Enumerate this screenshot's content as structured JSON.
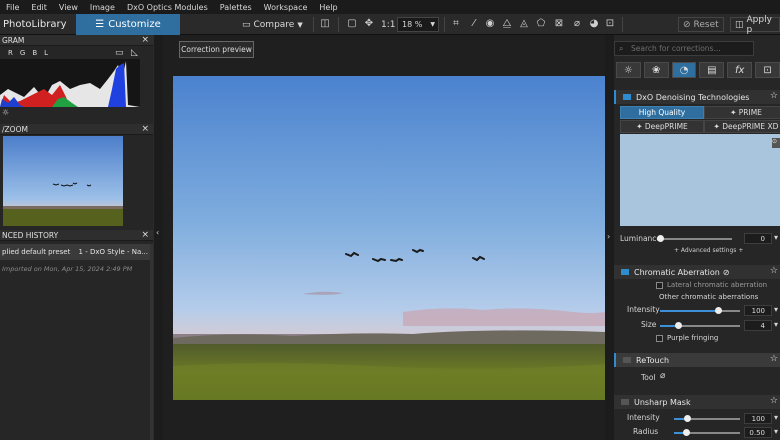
{
  "menu": [
    "File",
    "Edit",
    "View",
    "Image",
    "DxO Optics Modules",
    "Palettes",
    "Workspace",
    "Help"
  ],
  "toolbar": {
    "photolibrary": "PhotoLibrary",
    "customize": "Customize",
    "compare": "Compare",
    "ratio": "1:1",
    "zoom": "18 %",
    "reset": "Reset",
    "apply": "Apply p"
  },
  "left": {
    "histogram_title": "GRAM",
    "channels": [
      "R",
      "G",
      "B",
      "L"
    ],
    "loupe_title": "/ZOOM",
    "history_title": "NCED HISTORY",
    "history_items": [
      {
        "label": "plied default preset",
        "value": "1 - DxO Style - Na..."
      }
    ],
    "history_note": "Imported on Mon, Apr 15, 2024 2:49 PM"
  },
  "center": {
    "correction_preview": "Correction preview"
  },
  "right": {
    "search_placeholder": "Search for corrections...",
    "tabs": [
      "light-icon",
      "color-icon",
      "detail-icon",
      "geometry-icon",
      "fx-icon",
      "local-icon"
    ],
    "denoise": {
      "title": "DxO Denoising Technologies",
      "modes": [
        "High Quality",
        "PRIME",
        "DeepPRIME",
        "DeepPRIME XD"
      ],
      "luminance_label": "Luminance",
      "luminance_value": "0",
      "advanced": "+ Advanced settings +"
    },
    "chromatic": {
      "title": "Chromatic Aberration",
      "lateral": "Lateral chromatic aberration",
      "other": "Other chromatic aberrations",
      "intensity_label": "Intensity",
      "intensity_value": "100",
      "intensity_level": 1.0,
      "size_label": "Size",
      "size_value": "4",
      "size_level": 0.4,
      "purple": "Purple fringing"
    },
    "retouch": {
      "title": "ReTouch",
      "tool_label": "Tool"
    },
    "unsharp": {
      "title": "Unsharp Mask",
      "intensity_label": "Intensity",
      "intensity_value": "100",
      "radius_label": "Radius",
      "radius_value": "0.50"
    }
  },
  "colors": {
    "accent": "#2f6fa0",
    "slider": "#3d8fd8"
  }
}
